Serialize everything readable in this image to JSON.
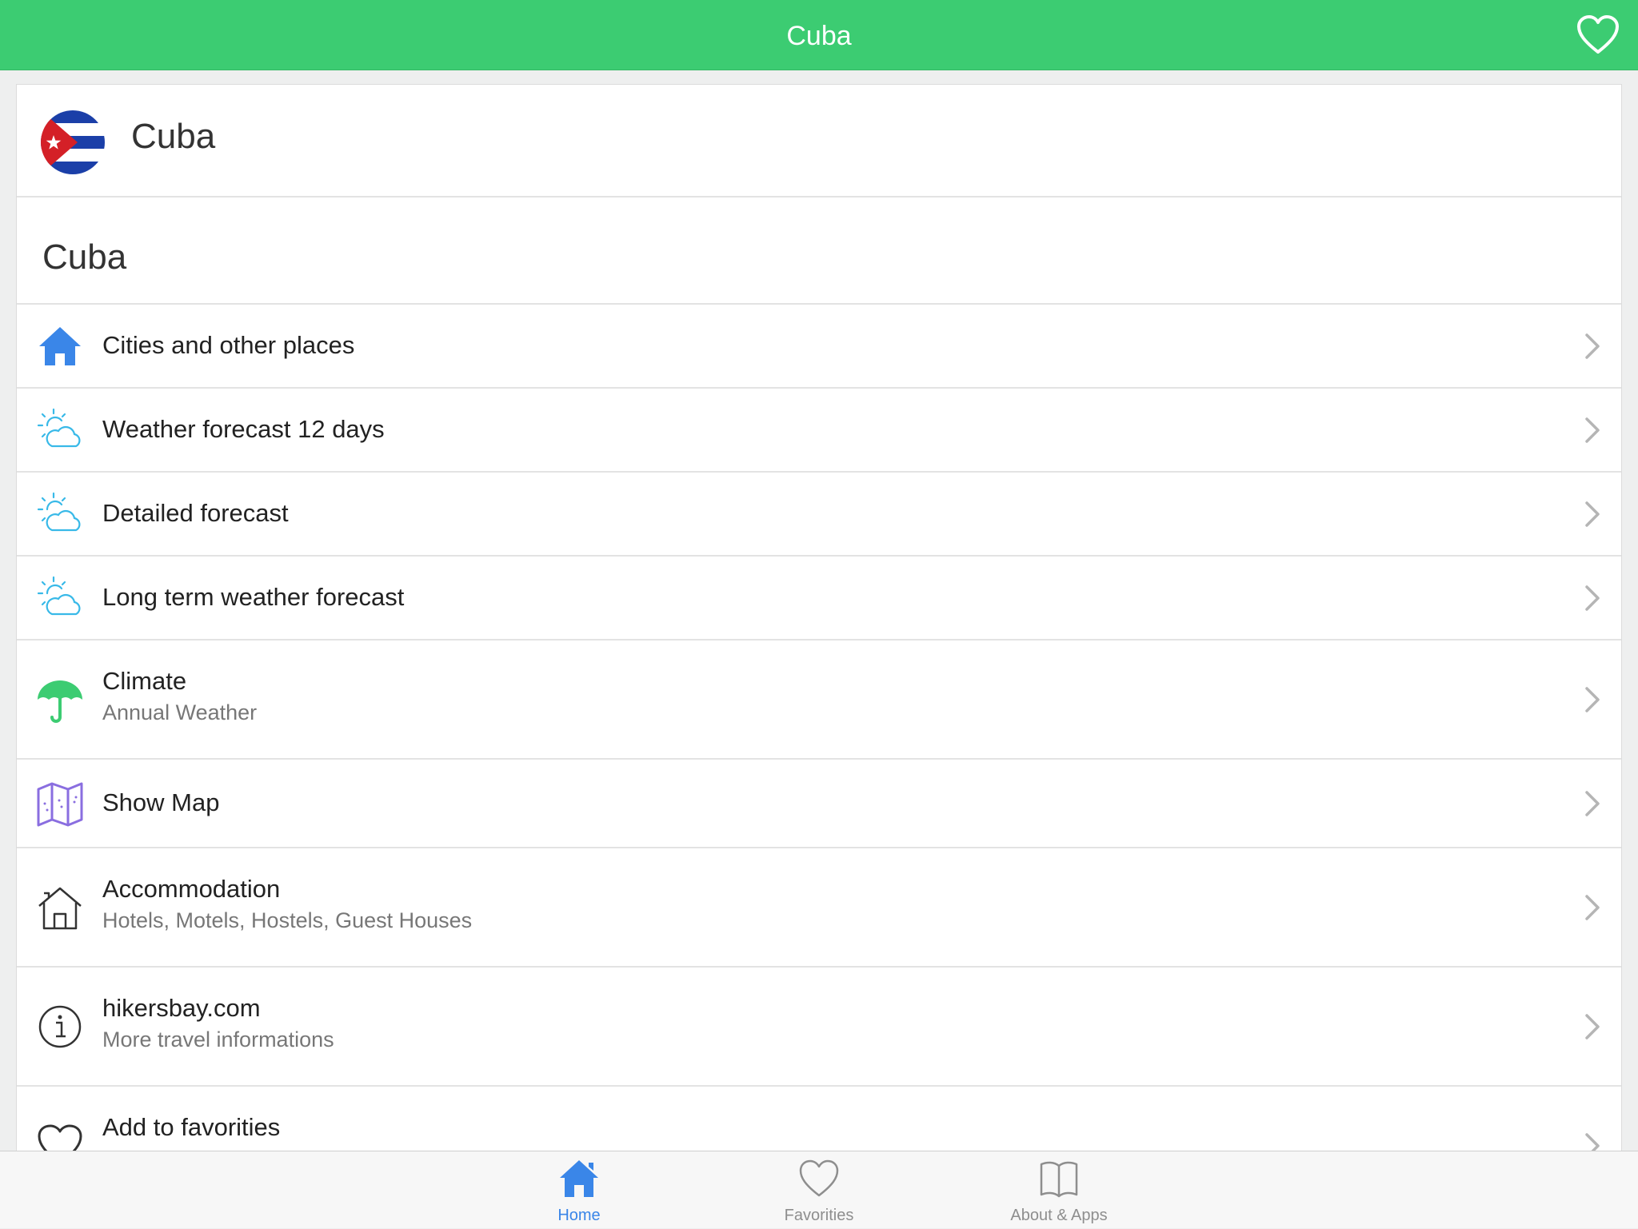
{
  "navbar": {
    "title": "Cuba",
    "favorite_icon": "heart-outline-icon"
  },
  "header": {
    "flag_icon": "cuba-flag-icon",
    "title": "Cuba"
  },
  "section": {
    "title": "Cuba"
  },
  "menu": {
    "items": [
      {
        "label": "Cities and other places",
        "icon": "home-icon",
        "icon_color": "#3a86e8"
      },
      {
        "label": "Weather forecast 12 days",
        "icon": "sun-cloud-icon",
        "icon_color": "#38b9e8"
      },
      {
        "label": "Detailed forecast",
        "icon": "sun-cloud-icon",
        "icon_color": "#38b9e8"
      },
      {
        "label": "Long term weather forecast",
        "icon": "sun-cloud-icon",
        "icon_color": "#38b9e8"
      },
      {
        "label": "Climate",
        "sublabel": "Annual Weather",
        "icon": "umbrella-icon",
        "icon_color": "#3ccc72"
      },
      {
        "label": "Show Map",
        "icon": "map-icon",
        "icon_color": "#8a6ee0"
      },
      {
        "label": "Accommodation",
        "sublabel": "Hotels, Motels, Hostels, Guest Houses",
        "icon": "house-outline-icon",
        "icon_color": "#333333"
      },
      {
        "label": "hikersbay.com",
        "sublabel": "More travel informations",
        "icon": "info-icon",
        "icon_color": "#333333"
      },
      {
        "label": "Add to favorities",
        "icon": "heart-outline-icon",
        "icon_color": "#333333"
      }
    ]
  },
  "tabbar": {
    "tabs": [
      {
        "label": "Home",
        "icon": "home-icon",
        "active": true
      },
      {
        "label": "Favorities",
        "icon": "heart-outline-icon",
        "active": false
      },
      {
        "label": "About & Apps",
        "icon": "book-icon",
        "active": false
      }
    ]
  },
  "colors": {
    "navbar": "#3ccc72",
    "accent": "#3a86e8"
  }
}
